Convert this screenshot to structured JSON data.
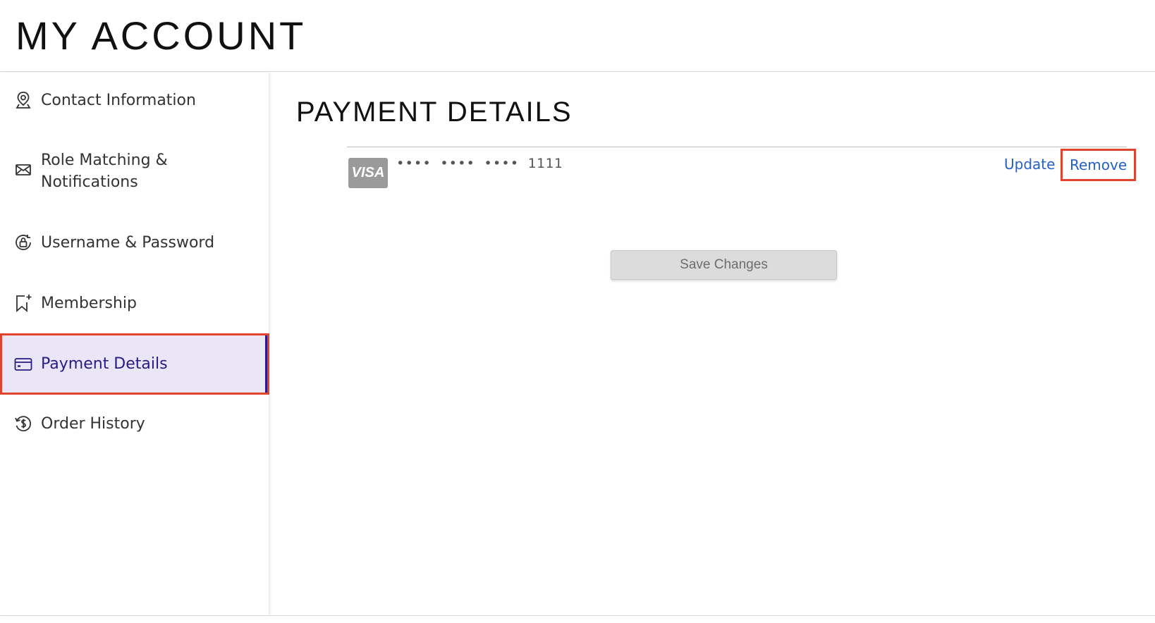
{
  "header": {
    "title": "MY ACCOUNT"
  },
  "sidebar": {
    "items": [
      {
        "label": "Contact Information",
        "icon": "location-pin-icon"
      },
      {
        "label": "Role Matching &",
        "label2": "Notifications",
        "icon": "envelope-icon"
      },
      {
        "label": "Username & Password",
        "icon": "lock-circle-icon"
      },
      {
        "label": "Membership",
        "icon": "bookmark-plus-icon"
      },
      {
        "label": "Payment Details",
        "icon": "credit-card-icon",
        "active": true
      },
      {
        "label": "Order History",
        "icon": "dollar-history-icon"
      }
    ]
  },
  "main": {
    "title": "PAYMENT DETAILS",
    "card": {
      "brand": "VISA",
      "masked_number": "•••• •••• •••• 1111",
      "update_label": "Update",
      "remove_label": "Remove"
    },
    "save_label": "Save Changes"
  },
  "colors": {
    "accent": "#2a1a86",
    "active_bg": "#ebe6f7",
    "highlight_border": "#e0432e",
    "link": "#2360c9"
  }
}
